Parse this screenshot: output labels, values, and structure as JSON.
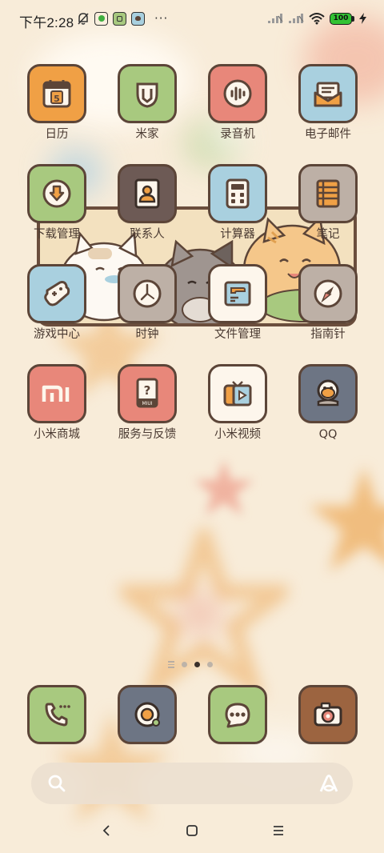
{
  "status_bar": {
    "time": "下午2:28",
    "left_icons": [
      "mute-bell-icon",
      "green-app-icon",
      "green-app-icon-2",
      "paw-app-icon"
    ],
    "more": "···",
    "battery": "100",
    "right_icons": [
      "signal-1-icon",
      "signal-2-icon",
      "wifi-icon",
      "battery-icon",
      "charging-icon"
    ]
  },
  "apps": [
    {
      "label": "日历",
      "icon": "calendar-icon",
      "color": "#f0a045",
      "badge": "5"
    },
    {
      "label": "米家",
      "icon": "mijia-icon",
      "color": "#a8c97f"
    },
    {
      "label": "录音机",
      "icon": "recorder-icon",
      "color": "#e8877a"
    },
    {
      "label": "电子邮件",
      "icon": "email-icon",
      "color": "#a9d0df"
    },
    {
      "label": "下载管理",
      "icon": "download-icon",
      "color": "#a8c97f"
    },
    {
      "label": "联系人",
      "icon": "contacts-icon",
      "color": "#6d5a55"
    },
    {
      "label": "计算器",
      "icon": "calculator-icon",
      "color": "#a9d0df"
    },
    {
      "label": "笔记",
      "icon": "notes-icon",
      "color": "#bdb0a6"
    },
    {
      "label": "游戏中心",
      "icon": "game-center-icon",
      "color": "#a9d0df"
    },
    {
      "label": "时钟",
      "icon": "clock-icon",
      "color": "#bdb0a6"
    },
    {
      "label": "文件管理",
      "icon": "file-manager-icon",
      "color": "#fdf6ec"
    },
    {
      "label": "指南针",
      "icon": "compass-icon",
      "color": "#bdb0a6"
    },
    {
      "label": "小米商城",
      "icon": "mi-store-icon",
      "color": "#e8877a"
    },
    {
      "label": "服务与反馈",
      "icon": "service-feedback-icon",
      "color": "#e8877a",
      "sub": "MIUI"
    },
    {
      "label": "小米视频",
      "icon": "mi-video-icon",
      "color": "#fdf6ec"
    },
    {
      "label": "QQ",
      "icon": "qq-icon",
      "color": "#6d7584"
    }
  ],
  "page_indicator": {
    "pages": 3,
    "active": 2
  },
  "dock": [
    {
      "icon": "phone-icon",
      "color": "#a8c97f"
    },
    {
      "icon": "browser-icon",
      "color": "#6d7584"
    },
    {
      "icon": "messages-icon",
      "color": "#a8c97f"
    },
    {
      "icon": "camera-icon",
      "color": "#9c6440"
    }
  ],
  "search": {
    "icon": "search-icon",
    "assistant": "xiaoai-icon"
  },
  "nav": {
    "back": "back-icon",
    "home": "home-icon",
    "menu": "recents-icon"
  },
  "colors": {
    "background": "#f8ecd9",
    "outline": "#5c4538",
    "label": "#4a3a32"
  }
}
